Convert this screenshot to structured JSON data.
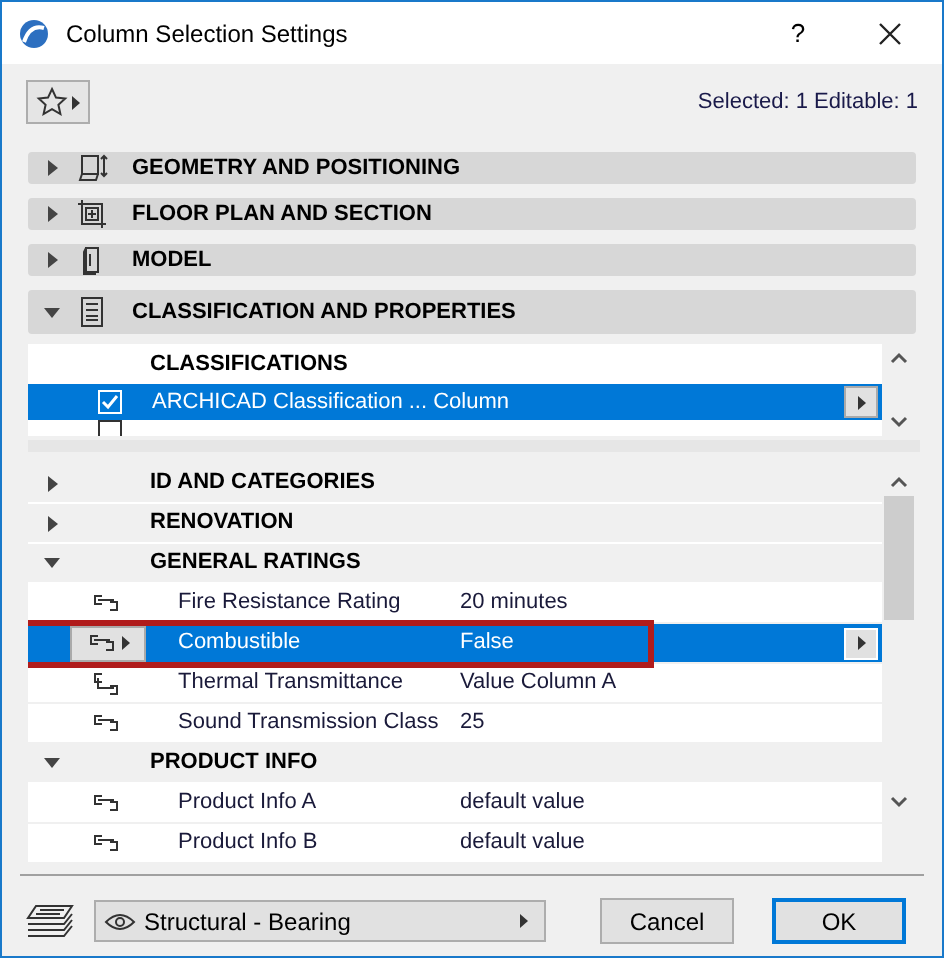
{
  "window": {
    "title": "Column Selection Settings",
    "help": "?"
  },
  "status": "Selected: 1 Editable: 1",
  "panels": [
    {
      "label": "GEOMETRY AND POSITIONING",
      "kind": "geometry",
      "expanded": false
    },
    {
      "label": "FLOOR PLAN AND SECTION",
      "kind": "plan",
      "expanded": false
    },
    {
      "label": "MODEL",
      "kind": "model",
      "expanded": false
    },
    {
      "label": "CLASSIFICATION AND PROPERTIES",
      "kind": "list",
      "expanded": true
    }
  ],
  "classifications": {
    "header": "CLASSIFICATIONS",
    "rows": [
      {
        "checked": true,
        "selected": true,
        "text": "ARCHICAD Classification ... Column"
      }
    ]
  },
  "properties": [
    {
      "kind": "group",
      "label": "ID AND CATEGORIES",
      "expanded": false
    },
    {
      "kind": "group",
      "label": "RENOVATION",
      "expanded": false
    },
    {
      "kind": "group",
      "label": "GENERAL RATINGS",
      "expanded": true
    },
    {
      "kind": "property",
      "name": "Fire Resistance Rating",
      "value": "20 minutes",
      "linked": true,
      "selected": false,
      "outlined": false
    },
    {
      "kind": "property",
      "name": "Combustible",
      "value": "False",
      "linked": true,
      "selected": true,
      "outlined": true
    },
    {
      "kind": "property",
      "name": "Thermal Transmittance",
      "value": "Value Column A",
      "linked": false,
      "selected": false,
      "outlined": false
    },
    {
      "kind": "property",
      "name": "Sound Transmission Class",
      "value": "25",
      "linked": true,
      "selected": false,
      "outlined": false
    },
    {
      "kind": "group",
      "label": "PRODUCT INFO",
      "expanded": true
    },
    {
      "kind": "property",
      "name": "Product Info A",
      "value": "default value",
      "linked": true,
      "selected": false,
      "outlined": false
    },
    {
      "kind": "property",
      "name": "Product Info B",
      "value": "default value",
      "linked": true,
      "selected": false,
      "outlined": false
    }
  ],
  "layer_dropdown": "Structural - Bearing",
  "buttons": [
    {
      "label": "Cancel",
      "default": false
    },
    {
      "label": "OK",
      "default": true
    }
  ]
}
